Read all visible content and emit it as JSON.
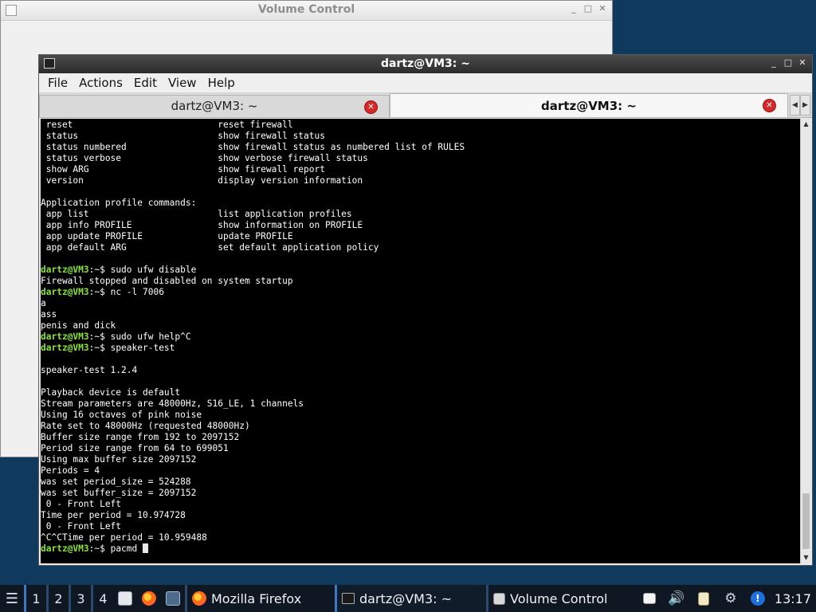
{
  "volume_window": {
    "title": "Volume Control",
    "controls": [
      "_",
      "□",
      "✕"
    ]
  },
  "terminal_window": {
    "title": "dartz@VM3: ~",
    "controls": [
      "_",
      "□",
      "✕"
    ],
    "menu": [
      "File",
      "Actions",
      "Edit",
      "View",
      "Help"
    ],
    "tabs": [
      {
        "label": "dartz@VM3: ~",
        "active": false
      },
      {
        "label": "dartz@VM3: ~",
        "active": true
      }
    ],
    "prompt_user": "dartz@VM3",
    "prompt_path": ":~$ ",
    "lines": [
      {
        "text": " reset                           reset firewall"
      },
      {
        "text": " status                          show firewall status"
      },
      {
        "text": " status numbered                 show firewall status as numbered list of RULES"
      },
      {
        "text": " status verbose                  show verbose firewall status"
      },
      {
        "text": " show ARG                        show firewall report"
      },
      {
        "text": " version                         display version information"
      },
      {
        "text": ""
      },
      {
        "text": "Application profile commands:"
      },
      {
        "text": " app list                        list application profiles"
      },
      {
        "text": " app info PROFILE                show information on PROFILE"
      },
      {
        "text": " app update PROFILE              update PROFILE"
      },
      {
        "text": " app default ARG                 set default application policy"
      },
      {
        "text": ""
      },
      {
        "prompt": true,
        "text": "sudo ufw disable"
      },
      {
        "text": "Firewall stopped and disabled on system startup"
      },
      {
        "prompt": true,
        "text": "nc -l 7006"
      },
      {
        "text": "a"
      },
      {
        "text": "ass"
      },
      {
        "text": "penis and dick"
      },
      {
        "prompt": true,
        "text": "sudo ufw help^C"
      },
      {
        "prompt": true,
        "text": "speaker-test"
      },
      {
        "text": ""
      },
      {
        "text": "speaker-test 1.2.4"
      },
      {
        "text": ""
      },
      {
        "text": "Playback device is default"
      },
      {
        "text": "Stream parameters are 48000Hz, S16_LE, 1 channels"
      },
      {
        "text": "Using 16 octaves of pink noise"
      },
      {
        "text": "Rate set to 48000Hz (requested 48000Hz)"
      },
      {
        "text": "Buffer size range from 192 to 2097152"
      },
      {
        "text": "Period size range from 64 to 699051"
      },
      {
        "text": "Using max buffer size 2097152"
      },
      {
        "text": "Periods = 4"
      },
      {
        "text": "was set period_size = 524288"
      },
      {
        "text": "was set buffer_size = 2097152"
      },
      {
        "text": " 0 - Front Left"
      },
      {
        "text": "Time per period = 10.974728"
      },
      {
        "text": " 0 - Front Left"
      },
      {
        "text": "^C^CTime per period = 10.959488"
      },
      {
        "prompt": true,
        "text": "pacmd ",
        "cursor": true
      }
    ]
  },
  "taskbar": {
    "desktops": [
      "1",
      "2",
      "3",
      "4"
    ],
    "active_desktop": "1",
    "tasks": [
      {
        "label": "Mozilla Firefox",
        "icon": "firefox-icon"
      },
      {
        "label": "dartz@VM3: ~",
        "icon": "terminal-icon"
      },
      {
        "label": "Volume Control",
        "icon": "volume-control-icon"
      }
    ],
    "clock": "13:17"
  }
}
